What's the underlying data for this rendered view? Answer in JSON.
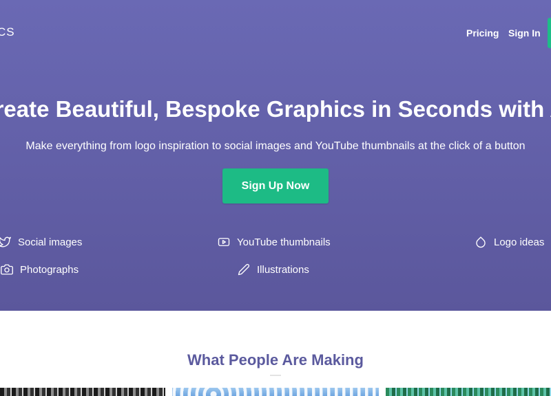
{
  "header": {
    "logo_text": "CS",
    "nav": [
      {
        "label": "Pricing"
      },
      {
        "label": "Sign In"
      }
    ]
  },
  "hero": {
    "title": "Create Beautiful, Bespoke Graphics in Seconds with AI",
    "subtitle": "Make everything from logo inspiration to social images and YouTube thumbnails at the click of a button",
    "cta_label": "Sign Up Now",
    "features": [
      {
        "label": "Social images",
        "icon": "twitter-icon"
      },
      {
        "label": "YouTube thumbnails",
        "icon": "youtube-icon"
      },
      {
        "label": "Logo ideas",
        "icon": "droplet-icon"
      },
      {
        "label": "Photographs",
        "icon": "camera-icon"
      },
      {
        "label": "Illustrations",
        "icon": "pencil-icon"
      }
    ]
  },
  "gallery": {
    "title": "What People Are Making"
  },
  "colors": {
    "hero_background": "#6462aa",
    "accent_green": "#1dbb85",
    "section_title": "#5b5a9e"
  }
}
